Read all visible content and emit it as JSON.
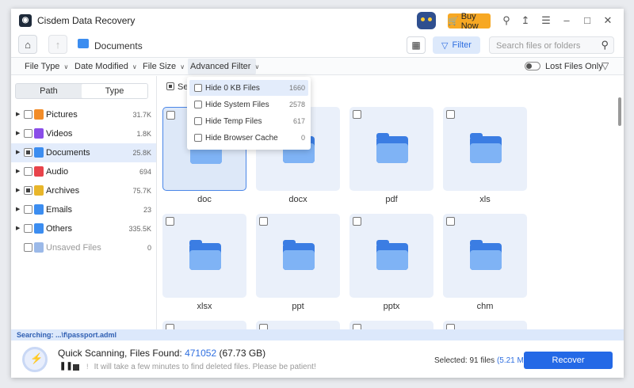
{
  "window": {
    "title": "Cisdem Data Recovery",
    "buy_label": "Buy Now"
  },
  "toolbar": {
    "breadcrumb": "Documents",
    "filter_label": "Filter",
    "search_placeholder": "Search files or folders"
  },
  "filter_row": {
    "items": [
      "File Type",
      "Date Modified",
      "File Size",
      "Advanced Filter"
    ],
    "lost_files_label": "Lost Files Only"
  },
  "sidebar": {
    "tabs": [
      "Path",
      "Type"
    ],
    "active_tab": "Type",
    "items": [
      {
        "label": "Pictures",
        "count": "31.7K",
        "icon_color": "#f28c28"
      },
      {
        "label": "Videos",
        "count": "1.8K",
        "icon_color": "#8a4de8"
      },
      {
        "label": "Documents",
        "count": "25.8K",
        "icon_color": "#3c8df0"
      },
      {
        "label": "Audio",
        "count": "694",
        "icon_color": "#e8434a"
      },
      {
        "label": "Archives",
        "count": "75.7K",
        "icon_color": "#e8b62a"
      },
      {
        "label": "Emails",
        "count": "23",
        "icon_color": "#3c8df0"
      },
      {
        "label": "Others",
        "count": "335.5K",
        "icon_color": "#3c8df0"
      },
      {
        "label": "Unsaved Files",
        "count": "0",
        "icon_color": "#9bb9e8"
      }
    ]
  },
  "content": {
    "select_all_label": "Sel",
    "tiles": [
      "doc",
      "docx",
      "pdf",
      "xls",
      "xlsx",
      "ppt",
      "pptx",
      "chm"
    ]
  },
  "dropdown": {
    "items": [
      {
        "label": "Hide 0 KB Files",
        "count": "1660"
      },
      {
        "label": "Hide System Files",
        "count": "2578"
      },
      {
        "label": "Hide Temp Files",
        "count": "617"
      },
      {
        "label": "Hide Browser Cache",
        "count": "0"
      }
    ]
  },
  "status": {
    "searching": "Searching: ...\\f\\passport.adml"
  },
  "bottom": {
    "scan_prefix": "Quick Scanning, Files Found: ",
    "files_found": "471052",
    "size": "(67.73 GB)",
    "hint": "It will take a few minutes to find deleted files. Please be patient!",
    "selected_prefix": "Selected: 91 files ",
    "selected_size": "(5.21 MB)",
    "recover_label": "Recover"
  },
  "colors": {
    "accent": "#2469e6",
    "folder": "#3b7de3",
    "buy": "#f7a823"
  }
}
